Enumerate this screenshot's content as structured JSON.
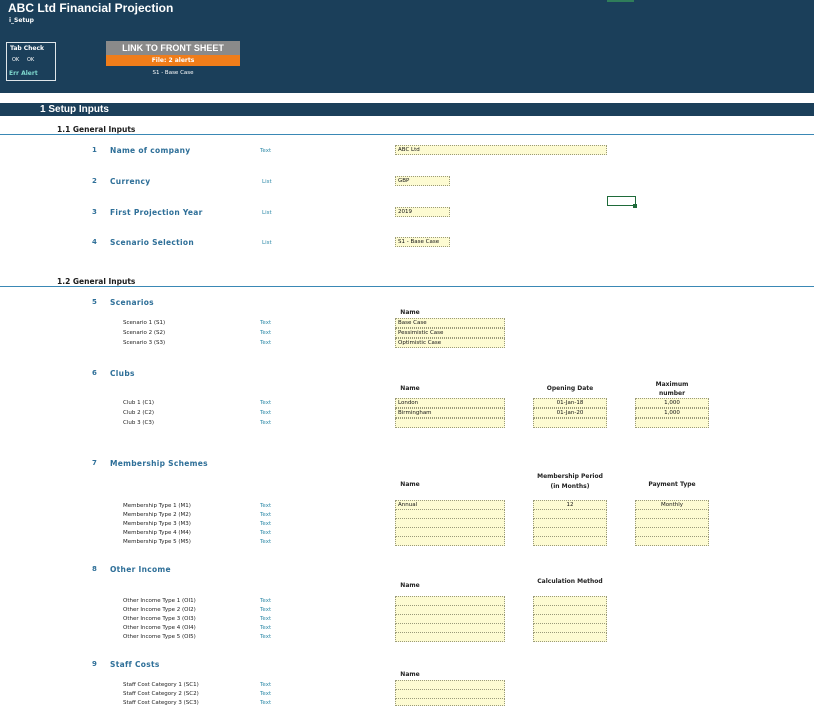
{
  "header": {
    "title": "ABC Ltd Financial Projection",
    "sheet": "i_Setup",
    "tab_check": {
      "title": "Tab Check",
      "ok1": "OK",
      "ok2": "OK",
      "err": "Err Alert"
    },
    "link_button": "LINK TO FRONT SHEET",
    "alert_text": "File: 2 alerts",
    "scenario_label": "S1 - Base Case"
  },
  "section1": {
    "title": "1    Setup Inputs"
  },
  "general1": {
    "title": "1.1   General Inputs",
    "items": [
      {
        "num": "1",
        "label": "Name of company",
        "type": "Text",
        "value": "ABC Ltd"
      },
      {
        "num": "2",
        "label": "Currency",
        "type": "List",
        "value": "GBP"
      },
      {
        "num": "3",
        "label": "First Projection Year",
        "type": "List",
        "value": "2019"
      },
      {
        "num": "4",
        "label": "Scenario Selection",
        "type": "List",
        "value": "S1 - Base Case"
      }
    ]
  },
  "general2": {
    "title": "1.2   General Inputs",
    "scenarios": {
      "num": "5",
      "label": "Scenarios",
      "col_name": "Name",
      "rows": [
        {
          "label": "Scenario 1 (S1)",
          "type": "Text",
          "name": "Base Case"
        },
        {
          "label": "Scenario 2 (S2)",
          "type": "Text",
          "name": "Pessimistic Case"
        },
        {
          "label": "Scenario 3 (S3)",
          "type": "Text",
          "name": "Optimistic Case"
        }
      ]
    },
    "clubs": {
      "num": "6",
      "label": "Clubs",
      "col_name": "Name",
      "col_date": "Opening Date",
      "col_max": "Maximum number",
      "rows": [
        {
          "label": "Club 1 (C1)",
          "type": "Text",
          "name": "London",
          "date": "01-Jan-18",
          "max": "1,000"
        },
        {
          "label": "Club 2 (C2)",
          "type": "Text",
          "name": "Birmingham",
          "date": "01-Jan-20",
          "max": "1,000"
        },
        {
          "label": "Club 3 (C3)",
          "type": "Text",
          "name": "",
          "date": "",
          "max": ""
        }
      ]
    },
    "membership": {
      "num": "7",
      "label": "Membership Schemes",
      "col_name": "Name",
      "col_period": "Membership Period (in Months)",
      "col_payment": "Payment Type",
      "rows": [
        {
          "label": "Membership Type 1 (M1)",
          "type": "Text",
          "name": "Annual",
          "period": "12",
          "payment": "Monthly"
        },
        {
          "label": "Membership Type 2 (M2)",
          "type": "Text",
          "name": "",
          "period": "",
          "payment": ""
        },
        {
          "label": "Membership Type 3 (M3)",
          "type": "Text",
          "name": "",
          "period": "",
          "payment": ""
        },
        {
          "label": "Membership Type 4 (M4)",
          "type": "Text",
          "name": "",
          "period": "",
          "payment": ""
        },
        {
          "label": "Membership Type 5 (M5)",
          "type": "Text",
          "name": "",
          "period": "",
          "payment": ""
        }
      ]
    },
    "other_income": {
      "num": "8",
      "label": "Other Income",
      "col_name": "Name",
      "col_calc": "Calculation Method",
      "rows": [
        {
          "label": "Other Income Type 1 (OI1)",
          "type": "Text"
        },
        {
          "label": "Other Income Type 2 (OI2)",
          "type": "Text"
        },
        {
          "label": "Other Income Type 3 (OI3)",
          "type": "Text"
        },
        {
          "label": "Other Income Type 4 (OI4)",
          "type": "Text"
        },
        {
          "label": "Other Income Type 5 (OI5)",
          "type": "Text"
        }
      ]
    },
    "staff": {
      "num": "9",
      "label": "Staff Costs",
      "col_name": "Name",
      "rows": [
        {
          "label": "Staff Cost Category 1 (SC1)",
          "type": "Text"
        },
        {
          "label": "Staff Cost Category 2 (SC2)",
          "type": "Text"
        },
        {
          "label": "Staff Cost Category 3 (SC3)",
          "type": "Text"
        }
      ]
    }
  }
}
